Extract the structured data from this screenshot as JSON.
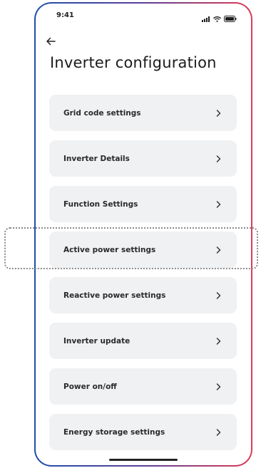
{
  "status_bar": {
    "time": "9:41",
    "icons": [
      "cellular-signal-icon",
      "wifi-icon",
      "battery-icon"
    ]
  },
  "header": {
    "back_icon": "back-arrow-icon",
    "title": "Inverter configuration"
  },
  "menu": {
    "items": [
      {
        "label": "Grid code settings"
      },
      {
        "label": "Inverter Details"
      },
      {
        "label": "Function Settings"
      },
      {
        "label": "Active power settings"
      },
      {
        "label": "Reactive power settings"
      },
      {
        "label": "Inverter update"
      },
      {
        "label": "Power on/off"
      },
      {
        "label": "Energy storage settings"
      }
    ],
    "chevron_icon": "chevron-right-icon",
    "highlighted_item": "Active power settings"
  },
  "colors": {
    "frame_gradient_start": "#1f4fa8",
    "frame_gradient_end": "#e03a55",
    "item_background": "#eff1f3",
    "text": "#2a2a2a"
  }
}
